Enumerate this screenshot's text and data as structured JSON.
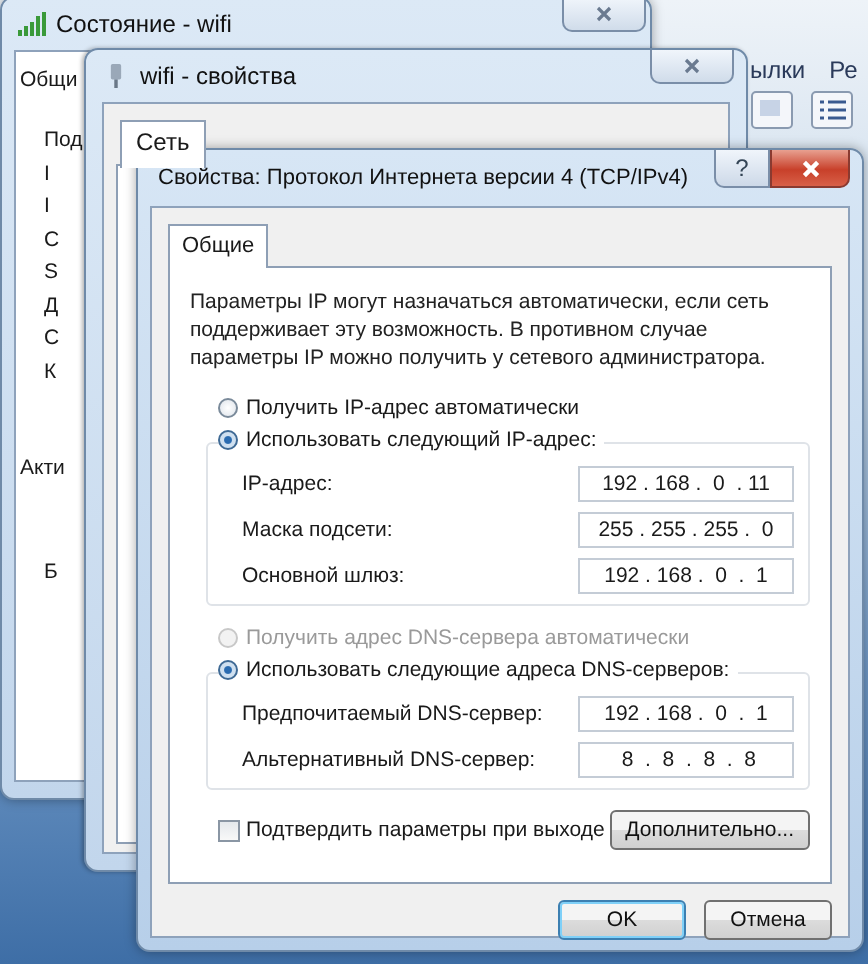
{
  "background_app": {
    "tabs": [
      "ылки",
      "Ре"
    ]
  },
  "status_window": {
    "title": "Состояние - wifi",
    "tab": "Общи",
    "lines": [
      "Под",
      "I",
      "I",
      "С",
      "S",
      "Д",
      "С",
      "К"
    ],
    "section": "Акти",
    "footer_fragment": "Б"
  },
  "properties_window": {
    "title": "wifi - свойства",
    "tab": "Сеть"
  },
  "dialog": {
    "title": "Свойства: Протокол Интернета версии 4 (TCP/IPv4)",
    "help": "?",
    "tabs": [
      {
        "label": "Общие",
        "selected": true
      }
    ],
    "description": "Параметры IP могут назначаться автоматически, если сеть поддерживает эту возможность. В противном случае параметры IP можно получить у сетевого администратора.",
    "ip_options": [
      {
        "label": "Получить IP-адрес автоматически",
        "selected": false,
        "disabled": false
      },
      {
        "label": "Использовать следующий IP-адрес:",
        "selected": true,
        "disabled": false
      }
    ],
    "ip_fields": [
      {
        "label": "IP-адрес:",
        "value": "192 . 168 .  0  . 11"
      },
      {
        "label": "Маска подсети:",
        "value": "255 . 255 . 255 .  0"
      },
      {
        "label": "Основной шлюз:",
        "value": "192 . 168 .  0  .  1"
      }
    ],
    "dns_options": [
      {
        "label": "Получить адрес DNS-сервера автоматически",
        "selected": false,
        "disabled": true
      },
      {
        "label": "Использовать следующие адреса DNS-серверов:",
        "selected": true,
        "disabled": false
      }
    ],
    "dns_fields": [
      {
        "label": "Предпочитаемый DNS-сервер:",
        "value": "192 . 168 .  0  .  1"
      },
      {
        "label": "Альтернативный DNS-сервер:",
        "value": " 8  .  8  .  8  .  8"
      }
    ],
    "confirm": {
      "label": "Подтвердить параметры при выходе",
      "checked": false
    },
    "advanced_button": "Дополнительно...",
    "buttons": [
      {
        "label": "OK",
        "default": true
      },
      {
        "label": "Отмена",
        "default": false
      }
    ]
  }
}
